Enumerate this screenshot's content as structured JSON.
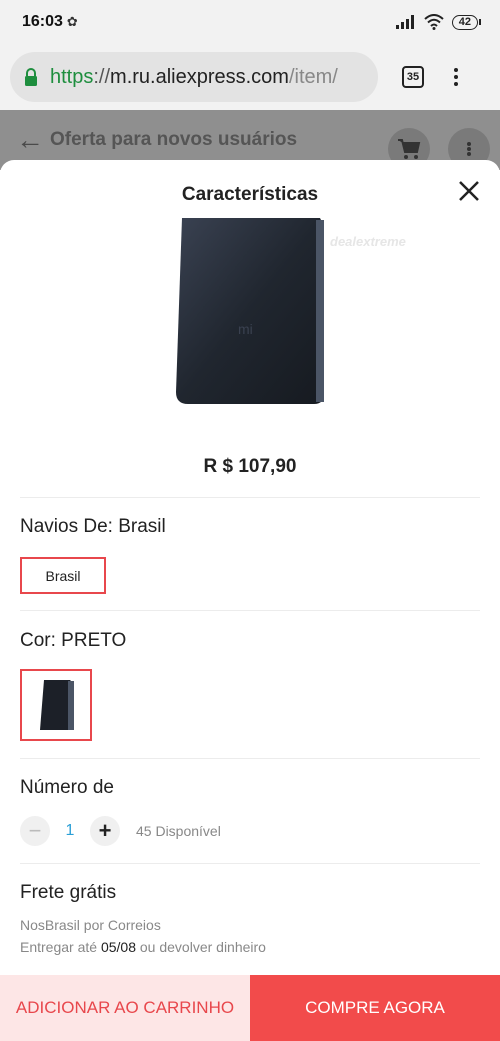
{
  "status_bar": {
    "time": "16:03",
    "battery": "42"
  },
  "browser": {
    "url_https": "https",
    "url_sep": "://",
    "url_domain": "m.ru.aliexpress.com",
    "url_path": "/item/",
    "tab_count": "35"
  },
  "page_behind": {
    "title": "Oferta para novos usuários"
  },
  "sheet": {
    "title": "Características",
    "watermark": "dealextreme",
    "price": "R $ 107,90",
    "ships_from": {
      "label": "Navios De: Brasil",
      "option": "Brasil"
    },
    "color": {
      "label": "Cor: PRETO"
    },
    "quantity": {
      "label": "Número de",
      "value": "1",
      "available": "45 Disponível"
    },
    "shipping": {
      "label": "Frete grátis",
      "carrier": "NosBrasil por Correios",
      "delivery_prefix": "Entregar até",
      "delivery_date": "05/08",
      "delivery_suffix": "ou devolver dinheiro"
    }
  },
  "buttons": {
    "add_to_cart": "ADICIONAR AO CARRINHO",
    "buy_now": "COMPRE AGORA"
  },
  "colors": {
    "accent": "#f24b4b",
    "accent_light": "#fde6e6",
    "url_green": "#1e8e3e",
    "qty_blue": "#2a9fd6"
  }
}
